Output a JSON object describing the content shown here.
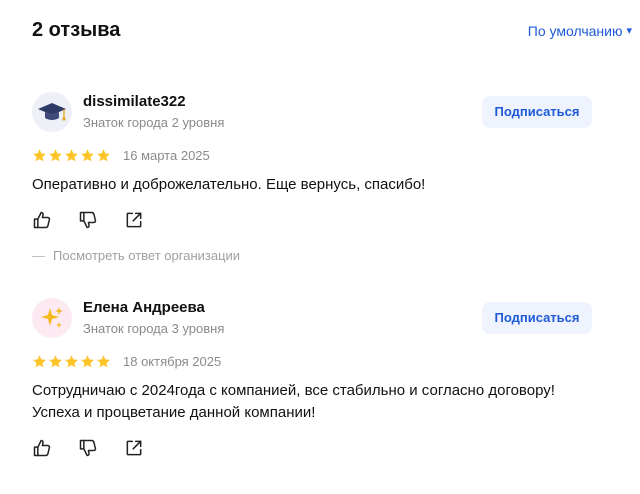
{
  "header": {
    "title": "2 отзыва",
    "sort_label": "По умолчанию",
    "sort_caret": "▾"
  },
  "colors": {
    "accent": "#1f5bd8",
    "button_bg": "#eef3fd",
    "star": "#fdc32b",
    "secondary_text": "#8a8a8a"
  },
  "reviews": [
    {
      "author": "dissimilate322",
      "level": "Знаток города 2 уровня",
      "avatar_icon": "graduation-cap-icon",
      "subscribe_label": "Подписаться",
      "rating": 5,
      "date": "16 марта 2025",
      "text": "Оперативно и доброжелательно. Еще вернусь, спасибо!",
      "org_answer_link": "Посмотреть ответ организации"
    },
    {
      "author": "Елена Андреева",
      "level": "Знаток города 3 уровня",
      "avatar_icon": "sparkles-icon",
      "subscribe_label": "Подписаться",
      "rating": 5,
      "date": "18 октября 2025",
      "text": "Сотрудничаю с 2024года с компанией, все стабильно и согласно договору! Успеха и процветание данной компании!"
    }
  ],
  "action_icons": [
    "like-icon",
    "dislike-icon",
    "share-icon"
  ]
}
